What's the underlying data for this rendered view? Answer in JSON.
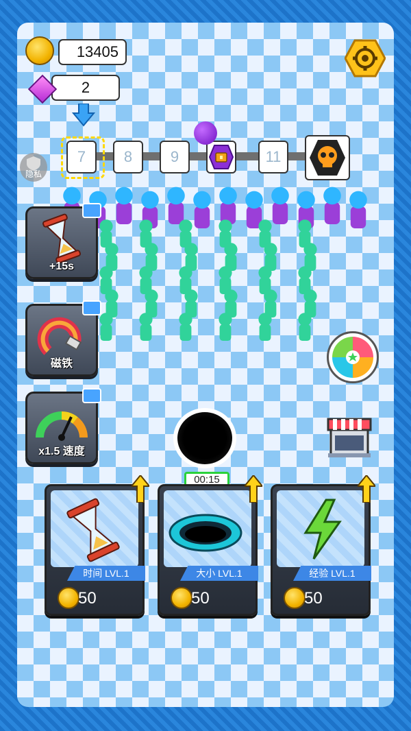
{
  "hud": {
    "coins": "13405",
    "gems": "2"
  },
  "progress": {
    "levels": [
      "7",
      "8",
      "9",
      "11"
    ],
    "current_marker_level": "7",
    "chest_label": "chest-icon",
    "boss_label": "skull-icon"
  },
  "privacy": {
    "label": "隐私"
  },
  "powerups": [
    {
      "label": "+15s",
      "icon": "hourglass-icon"
    },
    {
      "label": "磁铁",
      "icon": "magnet-icon"
    },
    {
      "label": "x1.5 速度",
      "icon": "speedometer-icon"
    }
  ],
  "timer": {
    "text": "00:15"
  },
  "upgrades": [
    {
      "level": "时间 LVL.1",
      "price": "50",
      "icon": "hourglass-icon"
    },
    {
      "level": "大小 LVL.1",
      "price": "50",
      "icon": "hole-icon"
    },
    {
      "level": "经验 LVL.1",
      "price": "50",
      "icon": "lightning-icon"
    }
  ],
  "colors": {
    "crowd_green": "#31d39a",
    "enemy_purple": "#9b3fd8",
    "enemy_blue": "#2fb6ff",
    "hole": "#000000"
  }
}
